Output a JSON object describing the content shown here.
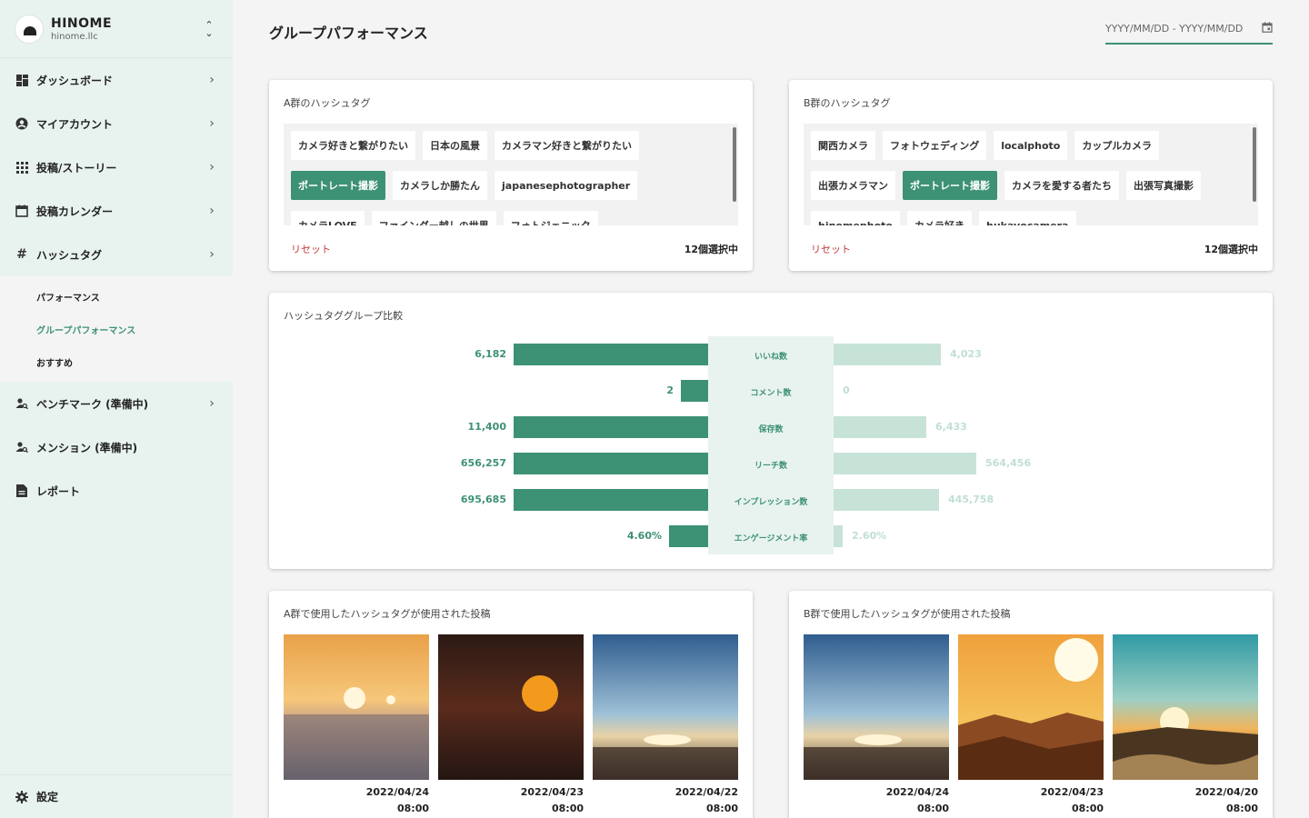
{
  "brand": {
    "name": "HINOME",
    "domain": "hinome.llc"
  },
  "sidebar": {
    "items": [
      {
        "label": "ダッシュボード",
        "icon": "dashboard-icon"
      },
      {
        "label": "マイアカウント",
        "icon": "account-circle-icon"
      },
      {
        "label": "投稿/ストーリー",
        "icon": "grid-icon"
      },
      {
        "label": "投稿カレンダー",
        "icon": "calendar-icon"
      },
      {
        "label": "ハッシュタグ",
        "icon": "hash-icon"
      },
      {
        "label": "ベンチマーク (準備中)",
        "icon": "person-search-icon"
      },
      {
        "label": "メンション (準備中)",
        "icon": "person-search-icon"
      },
      {
        "label": "レポート",
        "icon": "document-icon"
      }
    ],
    "subitems": [
      {
        "label": "パフォーマンス",
        "active": false
      },
      {
        "label": "グループパフォーマンス",
        "active": true
      },
      {
        "label": "おすすめ",
        "active": false
      }
    ],
    "settings": "設定"
  },
  "header": {
    "title": "グループパフォーマンス",
    "date_placeholder": "YYYY/MM/DD - YYYY/MM/DD"
  },
  "group_a": {
    "title": "A群のハッシュタグ",
    "tags": [
      {
        "label": "カメラ好きと繋がりたい",
        "selected": false
      },
      {
        "label": "日本の風景",
        "selected": false
      },
      {
        "label": "カメラマン好きと繋がりたい",
        "selected": false
      },
      {
        "label": "ポートレート撮影",
        "selected": true
      },
      {
        "label": "カメラしか勝たん",
        "selected": false
      },
      {
        "label": "japanesephotographer",
        "selected": false
      },
      {
        "label": "カメラLOVE",
        "selected": false
      },
      {
        "label": "ファインダー越しの世界",
        "selected": false
      },
      {
        "label": "フォトジェニック",
        "selected": false
      }
    ],
    "reset": "リセット",
    "count": "12個選択中"
  },
  "group_b": {
    "title": "B群のハッシュタグ",
    "tags": [
      {
        "label": "関西カメラ",
        "selected": false
      },
      {
        "label": "フォトウェディング",
        "selected": false
      },
      {
        "label": "localphoto",
        "selected": false
      },
      {
        "label": "カップルカメラ",
        "selected": false
      },
      {
        "label": "出張カメラマン",
        "selected": false
      },
      {
        "label": "ポートレート撮影",
        "selected": true
      },
      {
        "label": "カメラを愛する者たち",
        "selected": false
      },
      {
        "label": "出張写真撮影",
        "selected": false
      },
      {
        "label": "hinomephoto",
        "selected": false
      },
      {
        "label": "カメラ好き",
        "selected": false
      },
      {
        "label": "hukayocamera",
        "selected": false
      }
    ],
    "reset": "リセット",
    "count": "12個選択中"
  },
  "comparison": {
    "title": "ハッシュタググループ比較",
    "rows": [
      {
        "metric": "いいね数",
        "a": "6,182",
        "b": "4,023",
        "a_frac": 1.0,
        "b_frac": 0.65
      },
      {
        "metric": "コメント数",
        "a": "2",
        "b": "0",
        "a_frac": 0.14,
        "b_frac": 0.0
      },
      {
        "metric": "保存数",
        "a": "11,400",
        "b": "6,433",
        "a_frac": 1.0,
        "b_frac": 0.56
      },
      {
        "metric": "リーチ数",
        "a": "656,257",
        "b": "564,456",
        "a_frac": 1.0,
        "b_frac": 0.86
      },
      {
        "metric": "インプレッション数",
        "a": "695,685",
        "b": "445,758",
        "a_frac": 1.0,
        "b_frac": 0.64
      },
      {
        "metric": "エンゲージメント率",
        "a": "4.60%",
        "b": "2.60%",
        "a_frac": 0.2,
        "b_frac": 0.057
      }
    ],
    "colors": {
      "a": "#3d9175",
      "b": "#c7e3d8"
    }
  },
  "posts_a": {
    "title": "A群で使用したハッシュタグが使用された投稿",
    "items": [
      {
        "date": "2022/04/24",
        "time": "08:00",
        "image": "sunset-over-clouds"
      },
      {
        "date": "2022/04/23",
        "time": "08:00",
        "image": "red-sun-dark-sky"
      },
      {
        "date": "2022/04/22",
        "time": "08:00",
        "image": "blue-sky-sunrise-horizon"
      }
    ]
  },
  "posts_b": {
    "title": "B群で使用したハッシュタグが使用された投稿",
    "items": [
      {
        "date": "2022/04/24",
        "time": "08:00",
        "image": "blue-sky-sunrise-horizon"
      },
      {
        "date": "2022/04/23",
        "time": "08:00",
        "image": "orange-sun-mountains"
      },
      {
        "date": "2022/04/20",
        "time": "08:00",
        "image": "teal-sky-sunset-grass"
      }
    ]
  }
}
